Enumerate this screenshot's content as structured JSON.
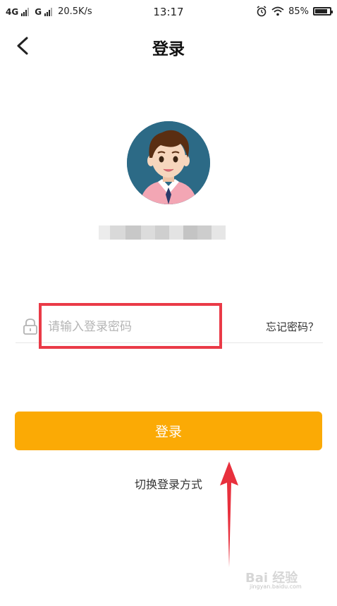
{
  "status_bar": {
    "network_1": "4G",
    "network_2": "G",
    "speed": "20.5K/s",
    "time": "13:17",
    "battery_text": "85%",
    "battery_level": 0.85,
    "icons": [
      "signal-icon",
      "alarm-icon",
      "wifi-icon",
      "battery-icon"
    ]
  },
  "nav": {
    "title": "登录",
    "back_icon": "chevron-left-icon"
  },
  "avatar": {
    "icon": "user-avatar",
    "colors": {
      "background": "#2c6a86",
      "hair": "#5a2e12",
      "skin": "#f6d6bd",
      "shirt": "#f3a6b4"
    }
  },
  "password": {
    "placeholder": "请输入登录密码",
    "value": "",
    "lock_icon": "lock-icon",
    "forgot_label": "忘记密码？"
  },
  "login_button_label": "登录",
  "switch_login_label": "切换登录方式",
  "annotation": {
    "highlight_color": "#ea3a47",
    "arrow_color": "#e8303d"
  },
  "watermark": {
    "logo_text": "Bai 经验",
    "url_text": "jingyan.baidu.com"
  },
  "colors": {
    "accent": "#fbaa05",
    "text": "#333333",
    "placeholder": "#b5b5b5"
  }
}
